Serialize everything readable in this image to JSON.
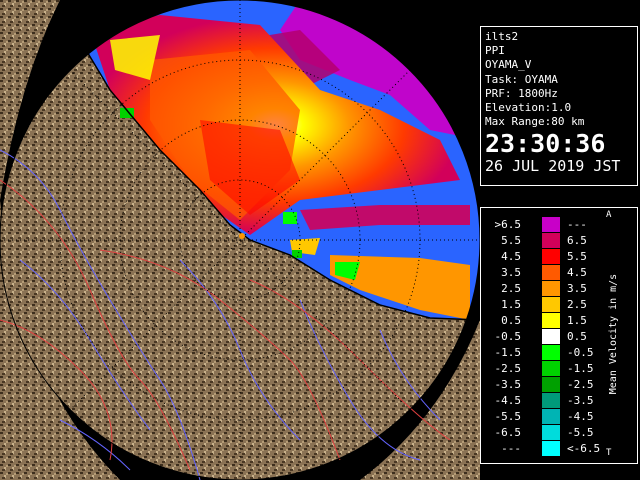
{
  "info": {
    "lines": [
      "ilts2",
      "PPI",
      "OYAMA_V",
      "Task: OYAMA",
      "PRF: 1800Hz",
      "Elevation:1.0",
      "Max Range:80 km"
    ],
    "time": "23:30:36",
    "date": "26 JUL 2019 JST"
  },
  "legend": {
    "unit_label": "Mean Velocity in m/s",
    "top_mark": "A",
    "bottom_mark": "T",
    "rows": [
      {
        "lo": ">6.5",
        "hi": "---",
        "color": "#c800c8"
      },
      {
        "lo": "5.5",
        "hi": "6.5",
        "color": "#d2005a"
      },
      {
        "lo": "4.5",
        "hi": "5.5",
        "color": "#ff0000"
      },
      {
        "lo": "3.5",
        "hi": "4.5",
        "color": "#ff5a00"
      },
      {
        "lo": "2.5",
        "hi": "3.5",
        "color": "#ff9600"
      },
      {
        "lo": "1.5",
        "hi": "2.5",
        "color": "#ffc800"
      },
      {
        "lo": "0.5",
        "hi": "1.5",
        "color": "#ffff00"
      },
      {
        "lo": "-0.5",
        "hi": "0.5",
        "color": "#ffffff"
      },
      {
        "lo": "-1.5",
        "hi": "-0.5",
        "color": "#00ff00"
      },
      {
        "lo": "-2.5",
        "hi": "-1.5",
        "color": "#00d200"
      },
      {
        "lo": "-3.5",
        "hi": "-2.5",
        "color": "#00a000"
      },
      {
        "lo": "-4.5",
        "hi": "-3.5",
        "color": "#009a7a"
      },
      {
        "lo": "-5.5",
        "hi": "-4.5",
        "color": "#00b4b4"
      },
      {
        "lo": "-6.5",
        "hi": "-5.5",
        "color": "#00dcdc"
      },
      {
        "lo": "---",
        "hi": "<-6.5",
        "color": "#00ffff"
      }
    ]
  },
  "colors": {
    "background": "#000000",
    "sea": "#2a64ff",
    "land": "#8c7456",
    "rivers": "#6464ff",
    "boundaries": "#e04040"
  }
}
